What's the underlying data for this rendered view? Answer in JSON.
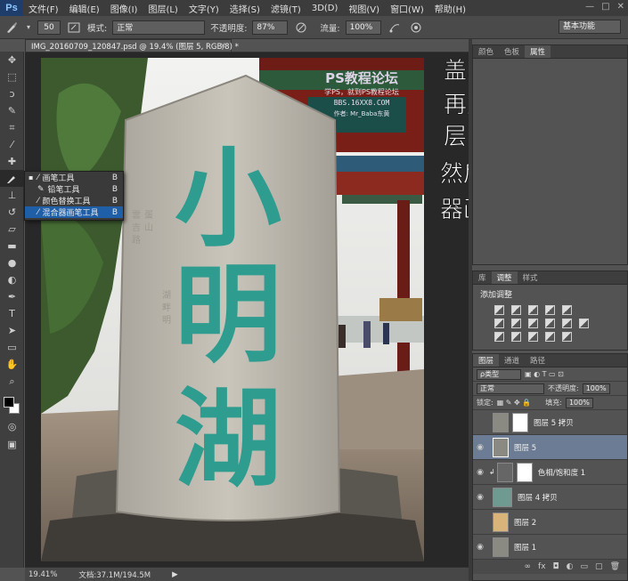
{
  "menubar": {
    "logo": "Ps",
    "items": [
      "文件(F)",
      "编辑(E)",
      "图像(I)",
      "图层(L)",
      "文字(Y)",
      "选择(S)",
      "滤镜(T)",
      "3D(D)",
      "视图(V)",
      "窗口(W)",
      "帮助(H)"
    ],
    "controls": [
      "—",
      "□",
      "✕"
    ]
  },
  "options": {
    "size": "50",
    "mode_label": "模式:",
    "mode_value": "正常",
    "opacity_label": "不透明度:",
    "opacity_value": "87%",
    "flow_label": "流量:",
    "flow_value": "100%",
    "workspace": "基本功能"
  },
  "document": {
    "tab_title": "IMG_20160709_120847.psd @ 19.4% (图层 5, RGB/8) *",
    "zoom": "19.41%",
    "doc_info": "文档:37.1M/194.5M"
  },
  "flyout": {
    "items": [
      {
        "label": "画笔工具",
        "key": "B"
      },
      {
        "label": "铅笔工具",
        "key": "B"
      },
      {
        "label": "颜色替换工具",
        "key": "B"
      },
      {
        "label": "混合器画笔工具",
        "key": "B"
      }
    ]
  },
  "image_text": {
    "watermark_title": "PS教程论坛",
    "watermark_sub": "学PS，就到PS教程论坛",
    "watermark_url": "BBS.16XX8.COM",
    "watermark_author": "作者: Mr_Baba东黄",
    "stone_chars": [
      "小",
      "明",
      "湖"
    ],
    "handwriting": [
      "盖印图层",
      "再复制盖印图",
      "层",
      "然后选择混合",
      "器画笔工具。"
    ]
  },
  "top_panel": {
    "tabs": [
      "颜色",
      "色板",
      "属性"
    ]
  },
  "adjust_panel": {
    "tabs": [
      "库",
      "调整",
      "样式"
    ],
    "title": "添加调整"
  },
  "layers_panel": {
    "tabs": [
      "图层",
      "通道",
      "路径"
    ],
    "filter": "ρ类型",
    "blend": "正常",
    "opacity_label": "不透明度:",
    "opacity_value": "100%",
    "lock_label": "锁定:",
    "fill_label": "填充:",
    "fill_value": "100%",
    "layers": [
      {
        "name": "图层 5 拷贝",
        "visible": false,
        "selected": false
      },
      {
        "name": "图层 5",
        "visible": true,
        "selected": true
      },
      {
        "name": "色相/饱和度 1",
        "visible": true,
        "selected": false
      },
      {
        "name": "图层 4 拷贝",
        "visible": true,
        "selected": false
      },
      {
        "name": "图层 2",
        "visible": false,
        "selected": false
      },
      {
        "name": "图层 1",
        "visible": true,
        "selected": false
      }
    ],
    "footer_icons": [
      "link-icon",
      "fx-icon",
      "mask-icon",
      "adjustment-icon",
      "group-icon",
      "new-layer-icon",
      "trash-icon"
    ]
  },
  "colors": {
    "selection_blue": "#1f5fa8",
    "layer_selected": "#6c7c94",
    "stone_text": "#2e9c8e"
  }
}
